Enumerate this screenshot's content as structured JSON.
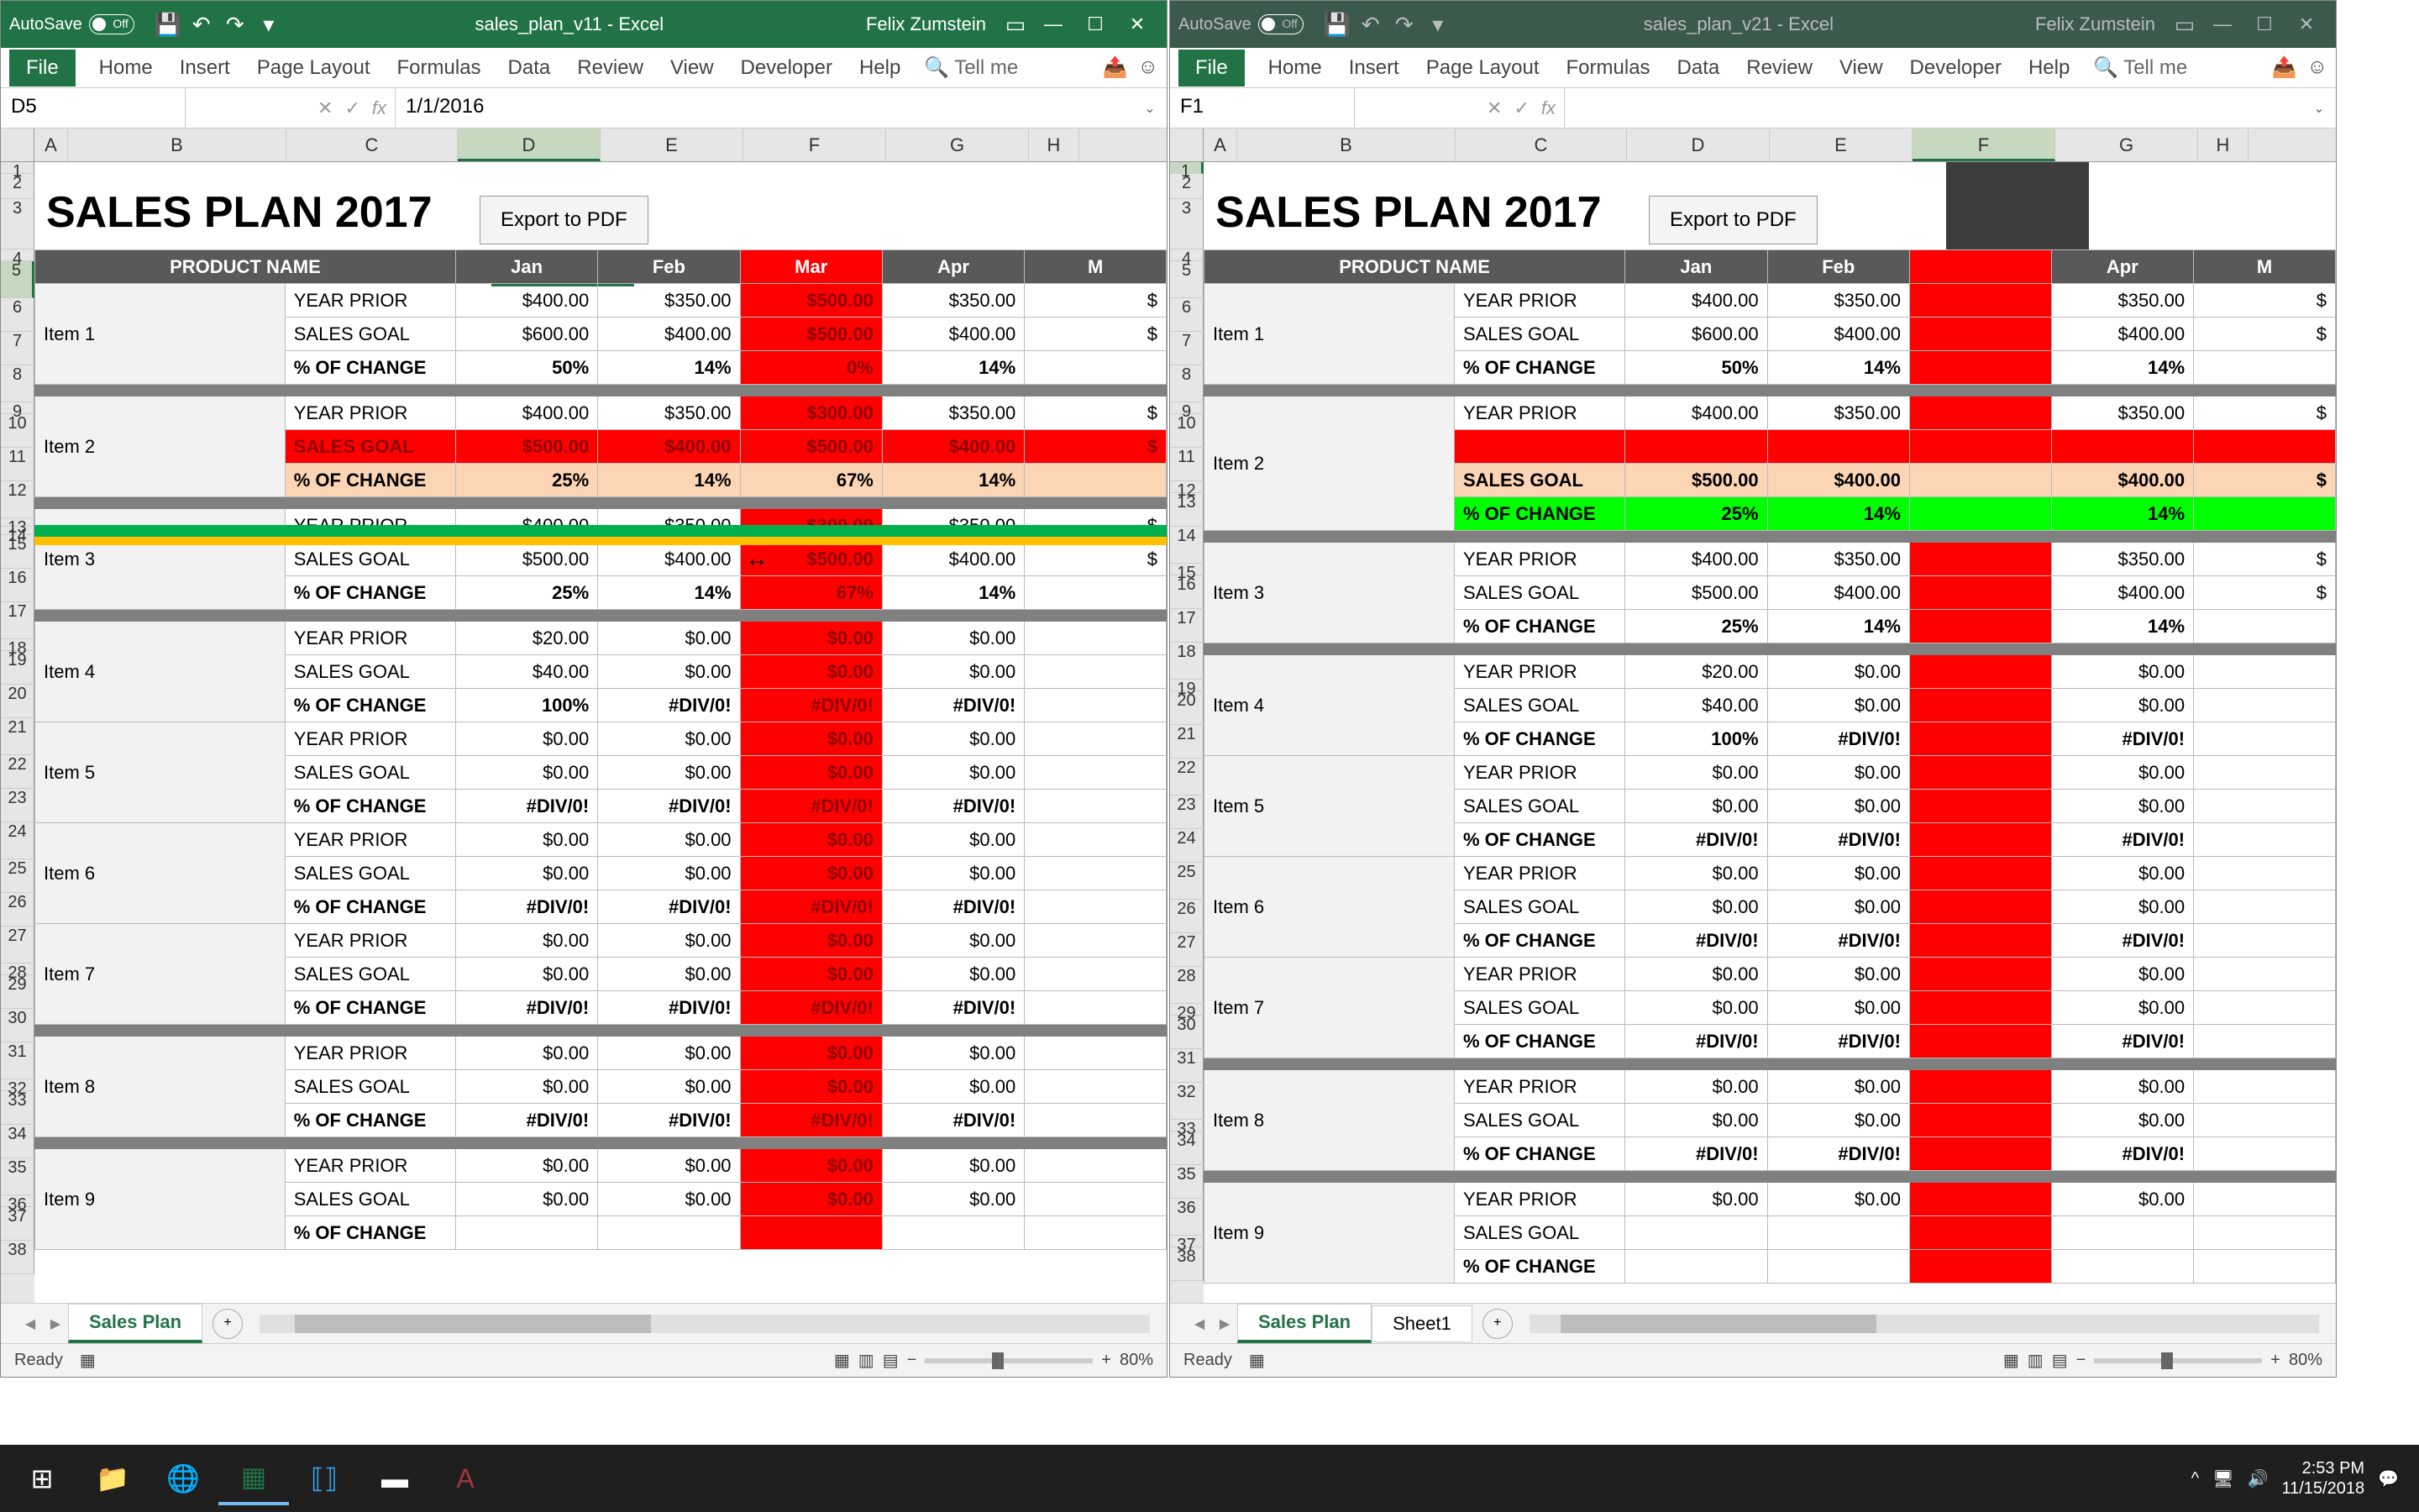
{
  "taskbar": {
    "datetime": {
      "time": "2:53 PM",
      "date": "11/15/2018"
    }
  },
  "left": {
    "titlebar": {
      "autosave": "AutoSave",
      "filename": "sales_plan_v11 - Excel",
      "user": "Felix Zumstein"
    },
    "ribbon": [
      "File",
      "Home",
      "Insert",
      "Page Layout",
      "Formulas",
      "Data",
      "Review",
      "View",
      "Developer",
      "Help"
    ],
    "tellme": "Tell me",
    "name_box": "D5",
    "formula": "1/1/2016",
    "cols": [
      "A",
      "B",
      "C",
      "D",
      "E",
      "F",
      "G",
      "H"
    ],
    "title": "SALES PLAN 2017",
    "export": "Export to PDF",
    "months": [
      "Jan",
      "Feb",
      "Mar",
      "Apr",
      "M"
    ],
    "product_header": "PRODUCT NAME",
    "metrics": {
      "yp": "YEAR PRIOR",
      "sg": "SALES GOAL",
      "pc": "% OF CHANGE"
    },
    "items": [
      {
        "name": "Item 1",
        "yp": [
          "$400.00",
          "$350.00",
          "$500.00",
          "$350.00",
          "$"
        ],
        "sg": [
          "$600.00",
          "$400.00",
          "$500.00",
          "$400.00",
          "$"
        ],
        "pc": [
          "50%",
          "14%",
          "0%",
          "14%",
          ""
        ]
      },
      {
        "name": "Item 2",
        "yp": [
          "$400.00",
          "$350.00",
          "$300.00",
          "$350.00",
          "$"
        ],
        "sg": [
          "$500.00",
          "$400.00",
          "$500.00",
          "$400.00",
          "$"
        ],
        "pc": [
          "25%",
          "14%",
          "67%",
          "14%",
          ""
        ]
      },
      {
        "name": "Item 3",
        "yp": [
          "$400.00",
          "$350.00",
          "$300.00",
          "$350.00",
          "$"
        ],
        "sg": [
          "$500.00",
          "$400.00",
          "$500.00",
          "$400.00",
          "$"
        ],
        "pc": [
          "25%",
          "14%",
          "67%",
          "14%",
          ""
        ]
      },
      {
        "name": "Item 4",
        "yp": [
          "$20.00",
          "$0.00",
          "$0.00",
          "$0.00",
          ""
        ],
        "sg": [
          "$40.00",
          "$0.00",
          "$0.00",
          "$0.00",
          ""
        ],
        "pc": [
          "100%",
          "#DIV/0!",
          "#DIV/0!",
          "#DIV/0!",
          ""
        ]
      },
      {
        "name": "Item 5",
        "yp": [
          "$0.00",
          "$0.00",
          "$0.00",
          "$0.00",
          ""
        ],
        "sg": [
          "$0.00",
          "$0.00",
          "$0.00",
          "$0.00",
          ""
        ],
        "pc": [
          "#DIV/0!",
          "#DIV/0!",
          "#DIV/0!",
          "#DIV/0!",
          ""
        ]
      },
      {
        "name": "Item 6",
        "yp": [
          "$0.00",
          "$0.00",
          "$0.00",
          "$0.00",
          ""
        ],
        "sg": [
          "$0.00",
          "$0.00",
          "$0.00",
          "$0.00",
          ""
        ],
        "pc": [
          "#DIV/0!",
          "#DIV/0!",
          "#DIV/0!",
          "#DIV/0!",
          ""
        ]
      },
      {
        "name": "Item 7",
        "yp": [
          "$0.00",
          "$0.00",
          "$0.00",
          "$0.00",
          ""
        ],
        "sg": [
          "$0.00",
          "$0.00",
          "$0.00",
          "$0.00",
          ""
        ],
        "pc": [
          "#DIV/0!",
          "#DIV/0!",
          "#DIV/0!",
          "#DIV/0!",
          ""
        ]
      },
      {
        "name": "Item 8",
        "yp": [
          "$0.00",
          "$0.00",
          "$0.00",
          "$0.00",
          ""
        ],
        "sg": [
          "$0.00",
          "$0.00",
          "$0.00",
          "$0.00",
          ""
        ],
        "pc": [
          "#DIV/0!",
          "#DIV/0!",
          "#DIV/0!",
          "#DIV/0!",
          ""
        ]
      },
      {
        "name": "Item 9",
        "yp": [
          "$0.00",
          "$0.00",
          "$0.00",
          "$0.00",
          ""
        ],
        "sg": [
          "$0.00",
          "$0.00",
          "$0.00",
          "$0.00",
          ""
        ],
        "pc": [
          "",
          "",
          "",
          "",
          ""
        ]
      }
    ],
    "sheets": [
      "Sales Plan"
    ],
    "status": "Ready",
    "zoom": "80%"
  },
  "right": {
    "titlebar": {
      "autosave": "AutoSave",
      "filename": "sales_plan_v21 - Excel",
      "user": "Felix Zumstein"
    },
    "ribbon": [
      "File",
      "Home",
      "Insert",
      "Page Layout",
      "Formulas",
      "Data",
      "Review",
      "View",
      "Developer",
      "Help"
    ],
    "tellme": "Tell me",
    "name_box": "F1",
    "formula": "",
    "cols": [
      "A",
      "B",
      "C",
      "D",
      "E",
      "F",
      "G",
      "H"
    ],
    "title": "SALES PLAN 2017",
    "export": "Export to PDF",
    "months": [
      "Jan",
      "Feb",
      "",
      "Apr",
      "M"
    ],
    "product_header": "PRODUCT NAME",
    "metrics": {
      "yp": "YEAR PRIOR",
      "sg": "SALES GOAL",
      "pc": "% OF CHANGE"
    },
    "items": [
      {
        "name": "Item 1",
        "yp": [
          "$400.00",
          "$350.00",
          "",
          "$350.00",
          "$"
        ],
        "sg": [
          "$600.00",
          "$400.00",
          "",
          "$400.00",
          "$"
        ],
        "pc": [
          "50%",
          "14%",
          "",
          "14%",
          ""
        ]
      },
      {
        "name": "Item 2",
        "yp": [
          "$400.00",
          "$350.00",
          "",
          "$350.00",
          "$"
        ],
        "sg": [
          "$500.00",
          "$400.00",
          "",
          "$400.00",
          "$"
        ],
        "pc": [
          "25%",
          "14%",
          "",
          "14%",
          ""
        ]
      },
      {
        "name": "Item 3",
        "yp": [
          "$400.00",
          "$350.00",
          "",
          "$350.00",
          "$"
        ],
        "sg": [
          "$500.00",
          "$400.00",
          "",
          "$400.00",
          "$"
        ],
        "pc": [
          "25%",
          "14%",
          "",
          "14%",
          ""
        ]
      },
      {
        "name": "Item 4",
        "yp": [
          "$20.00",
          "$0.00",
          "",
          "$0.00",
          ""
        ],
        "sg": [
          "$40.00",
          "$0.00",
          "",
          "$0.00",
          ""
        ],
        "pc": [
          "100%",
          "#DIV/0!",
          "",
          "#DIV/0!",
          ""
        ]
      },
      {
        "name": "Item 5",
        "yp": [
          "$0.00",
          "$0.00",
          "",
          "$0.00",
          ""
        ],
        "sg": [
          "$0.00",
          "$0.00",
          "",
          "$0.00",
          ""
        ],
        "pc": [
          "#DIV/0!",
          "#DIV/0!",
          "",
          "#DIV/0!",
          ""
        ]
      },
      {
        "name": "Item 6",
        "yp": [
          "$0.00",
          "$0.00",
          "",
          "$0.00",
          ""
        ],
        "sg": [
          "$0.00",
          "$0.00",
          "",
          "$0.00",
          ""
        ],
        "pc": [
          "#DIV/0!",
          "#DIV/0!",
          "",
          "#DIV/0!",
          ""
        ]
      },
      {
        "name": "Item 7",
        "yp": [
          "$0.00",
          "$0.00",
          "",
          "$0.00",
          ""
        ],
        "sg": [
          "$0.00",
          "$0.00",
          "",
          "$0.00",
          ""
        ],
        "pc": [
          "#DIV/0!",
          "#DIV/0!",
          "",
          "#DIV/0!",
          ""
        ]
      },
      {
        "name": "Item 8",
        "yp": [
          "$0.00",
          "$0.00",
          "",
          "$0.00",
          ""
        ],
        "sg": [
          "$0.00",
          "$0.00",
          "",
          "$0.00",
          ""
        ],
        "pc": [
          "#DIV/0!",
          "#DIV/0!",
          "",
          "#DIV/0!",
          ""
        ]
      },
      {
        "name": "Item 9",
        "yp": [
          "$0.00",
          "$0.00",
          "",
          "$0.00",
          ""
        ],
        "sg": [
          "",
          "",
          "",
          "",
          ""
        ],
        "pc": [
          "",
          "",
          "",
          "",
          ""
        ]
      }
    ],
    "sheets": [
      "Sales Plan",
      "Sheet1"
    ],
    "status": "Ready",
    "zoom": "80%"
  }
}
